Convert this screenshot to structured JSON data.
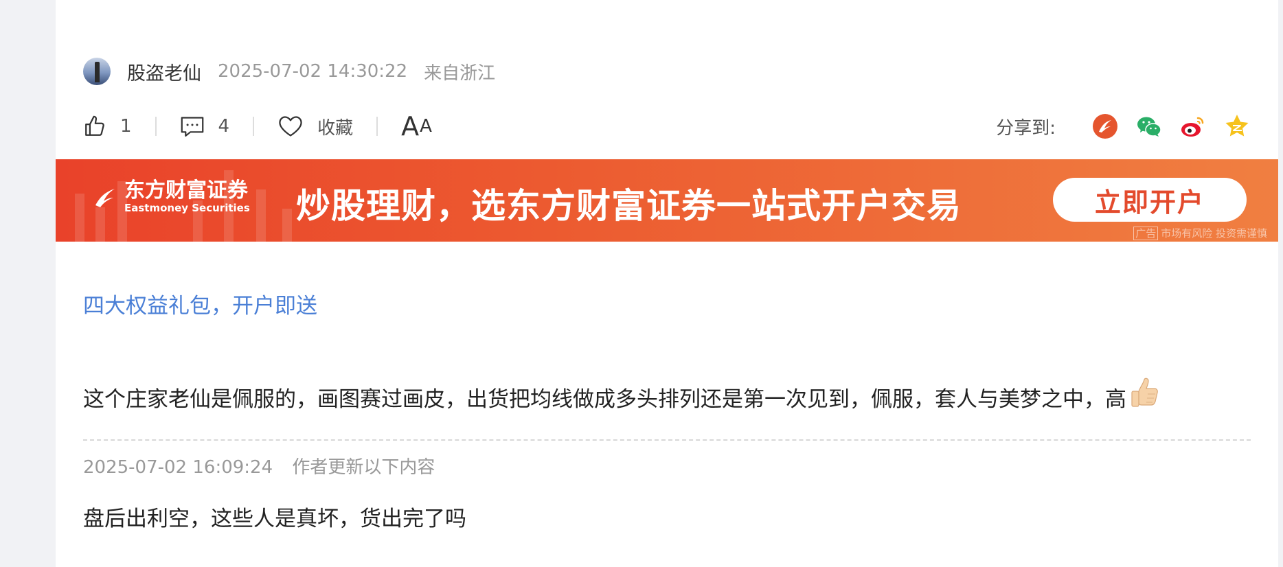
{
  "author": {
    "name": "股盗老仙",
    "time": "2025-07-02 14:30:22",
    "location": "来自浙江"
  },
  "actions": {
    "like_count": "1",
    "comment_count": "4",
    "collect_label": "收藏",
    "font_size_large": "A",
    "font_size_small": "A"
  },
  "share": {
    "label": "分享到:",
    "targets": [
      "eastmoney-icon",
      "wechat-icon",
      "weibo-icon",
      "qzone-icon"
    ]
  },
  "banner": {
    "brand_cn": "东方财富证券",
    "brand_en": "Eastmoney Securities",
    "slogan": "炒股理财，选东方财富证券一站式开户交易",
    "cta": "立即开户",
    "ad_tag": "广告",
    "disclaimer": "市场有风险 投资需谨慎",
    "colors": {
      "start": "#e9422a",
      "end": "#f07f41"
    }
  },
  "promo_link": "四大权益礼包，开户即送",
  "post": {
    "content": "这个庄家老仙是佩服的，画图赛过画皮，出货把均线做成多头排列还是第一次见到，佩服，套人与美梦之中，高",
    "emoji": "thumbs-up-icon"
  },
  "update": {
    "time": "2025-07-02 16:09:24",
    "label": "作者更新以下内容",
    "content": "盘后出利空，这些人是真坏，货出完了吗"
  },
  "colors": {
    "link": "#4a7fd6",
    "meta": "#999999",
    "text": "#222222"
  }
}
